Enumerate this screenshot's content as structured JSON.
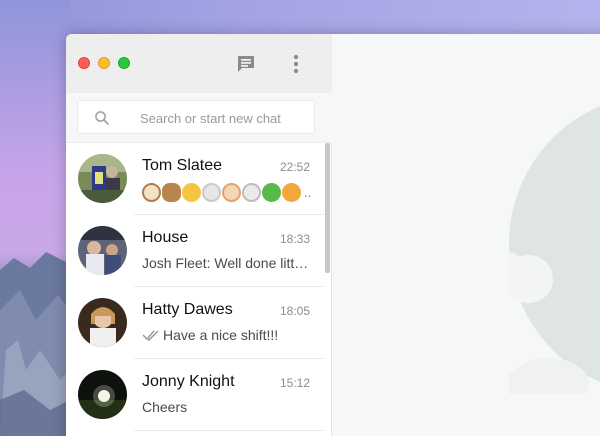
{
  "sidebar": {
    "search": {
      "placeholder": "Search or start new chat"
    },
    "chats": [
      {
        "name": "Tom Slatee",
        "time": "22:52",
        "preview_type": "emoji",
        "emojis": [
          "dog-face-icon",
          "horse-face-icon",
          "cat-face-icon",
          "mouse-face-icon",
          "hamster-face-icon",
          "rabbit-face-icon",
          "frog-face-icon",
          "tiger-face-icon"
        ],
        "ellipsis": ".."
      },
      {
        "name": "House",
        "time": "18:33",
        "preview": "Josh Fleet: Well done litt…"
      },
      {
        "name": "Hatty Dawes",
        "time": "18:05",
        "preview": "Have a nice shift!!!",
        "read_receipt": "double-check-icon"
      },
      {
        "name": "Jonny Knight",
        "time": "15:12",
        "preview": "Cheers"
      }
    ]
  },
  "colors": {
    "close": "#fc5f57",
    "minimize": "#fdbc2e",
    "maximize": "#28c840",
    "icon_gray": "#8a8a8a"
  }
}
